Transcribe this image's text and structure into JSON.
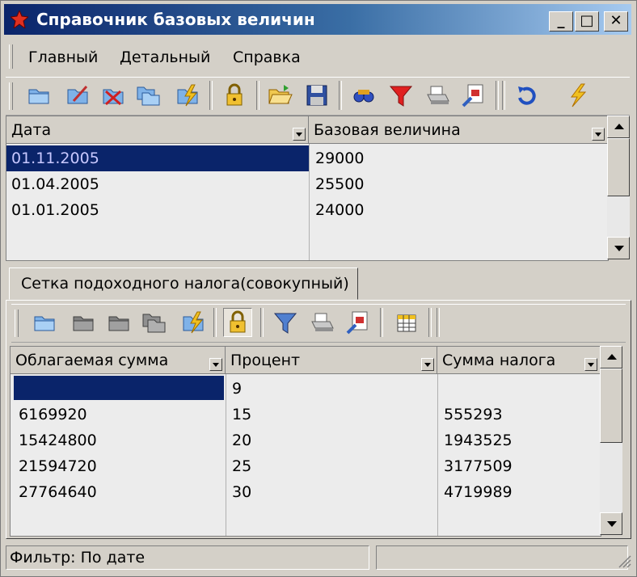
{
  "window": {
    "title": "Справочник базовых величин",
    "buttons": {
      "minimize": "_",
      "maximize": "□",
      "close": "✕"
    }
  },
  "menu": {
    "items": [
      {
        "label": "Главный"
      },
      {
        "label": "Детальный"
      },
      {
        "label": "Справка"
      }
    ]
  },
  "main_toolbar": {
    "icons": [
      "folder-open-icon",
      "edit-icon",
      "delete-icon",
      "copy-folder-icon",
      "lightning-edit-icon",
      "lock-icon",
      "open-file-icon",
      "save-icon",
      "find-icon",
      "filter-icon",
      "print-icon",
      "report-icon",
      "refresh-icon",
      "lightning-icon"
    ]
  },
  "top_grid": {
    "columns": [
      "Дата",
      "Базовая величина"
    ],
    "rows": [
      {
        "date": "01.11.2005",
        "value": "29000",
        "selected": true
      },
      {
        "date": "01.04.2005",
        "value": "25500",
        "selected": false
      },
      {
        "date": "01.01.2005",
        "value": "24000",
        "selected": false
      }
    ]
  },
  "tab": {
    "label": "Сетка подоходного налога(совокупный)"
  },
  "detail_toolbar": {
    "icons": [
      "folder-open-icon",
      "edit-icon",
      "delete-icon",
      "copy-icon",
      "lightning-edit-icon",
      "lock-icon",
      "filter-icon",
      "print-icon",
      "report-icon",
      "table-icon"
    ]
  },
  "bottom_grid": {
    "columns": [
      "Облагаемая сумма",
      "Процент",
      "Сумма налога"
    ],
    "rows": [
      {
        "taxable": "",
        "percent": "9",
        "tax": "",
        "selected": true
      },
      {
        "taxable": "6169920",
        "percent": "15",
        "tax": "555293",
        "selected": false
      },
      {
        "taxable": "15424800",
        "percent": "20",
        "tax": "1943525",
        "selected": false
      },
      {
        "taxable": "21594720",
        "percent": "25",
        "tax": "3177509",
        "selected": false
      },
      {
        "taxable": "27764640",
        "percent": "30",
        "tax": "4719989",
        "selected": false
      }
    ]
  },
  "status": {
    "filter_text": "Фильтр: По дате",
    "panel2": ""
  }
}
